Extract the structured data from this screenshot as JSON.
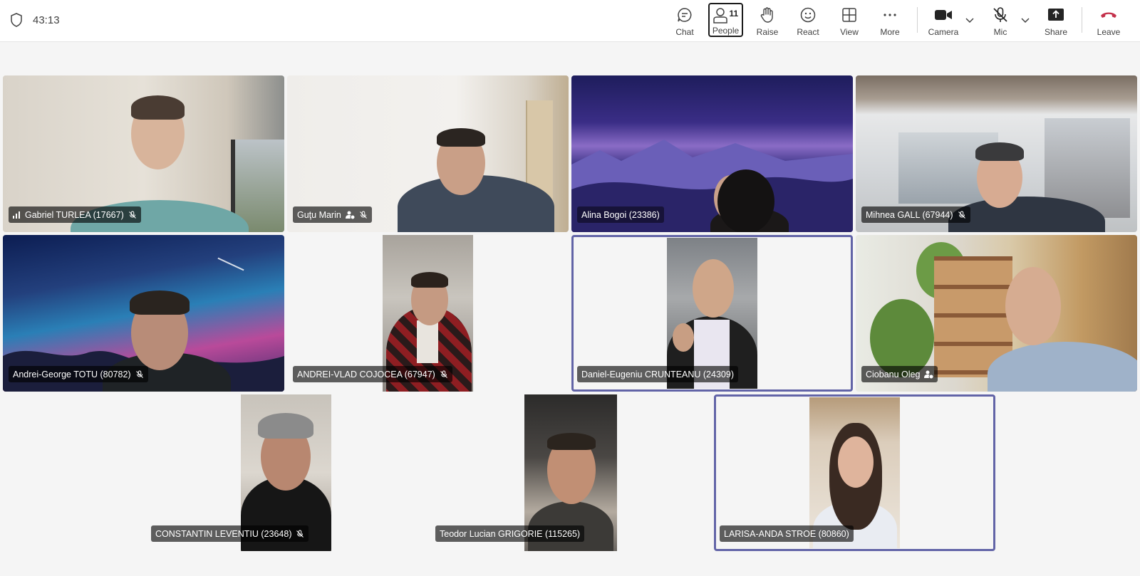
{
  "call": {
    "timer": "43:13"
  },
  "toolbar": {
    "chat": "Chat",
    "people": "People",
    "people_count": "11",
    "raise": "Raise",
    "react": "React",
    "view": "View",
    "more": "More",
    "camera": "Camera",
    "mic": "Mic",
    "share": "Share",
    "leave": "Leave"
  },
  "participants": [
    {
      "name": "Gabriel TURLEA (17667)",
      "muted": true
    },
    {
      "name": "Guţu Marin",
      "muted": true
    },
    {
      "name": "Alina Bogoi (23386)",
      "muted": false
    },
    {
      "name": "Mihnea GALL (67944)",
      "muted": true
    },
    {
      "name": "Andrei-George TOTU (80782)",
      "muted": true
    },
    {
      "name": "ANDREI-VLAD COJOCEA (67947)",
      "muted": true
    },
    {
      "name": "Daniel-Eugeniu CRUNTEANU (24309)",
      "muted": false,
      "speaking": true
    },
    {
      "name": "Ciobanu Oleg",
      "muted": false
    },
    {
      "name": "CONSTANTIN LEVENTIU (23648)",
      "muted": true
    },
    {
      "name": "Teodor Lucian GRIGORIE (115265)",
      "muted": false
    },
    {
      "name": "LARISA-ANDA STROE (80860)",
      "muted": false,
      "speaking": true
    }
  ],
  "colors": {
    "accent": "#6264a7",
    "leave": "#c4314b"
  },
  "icons": [
    "shield-icon",
    "chat-icon",
    "people-icon",
    "raise-hand-icon",
    "react-icon",
    "view-icon",
    "more-icon",
    "camera-icon",
    "mic-off-icon",
    "share-icon",
    "leave-phone-icon",
    "chevron-down-icon",
    "signal-icon"
  ]
}
